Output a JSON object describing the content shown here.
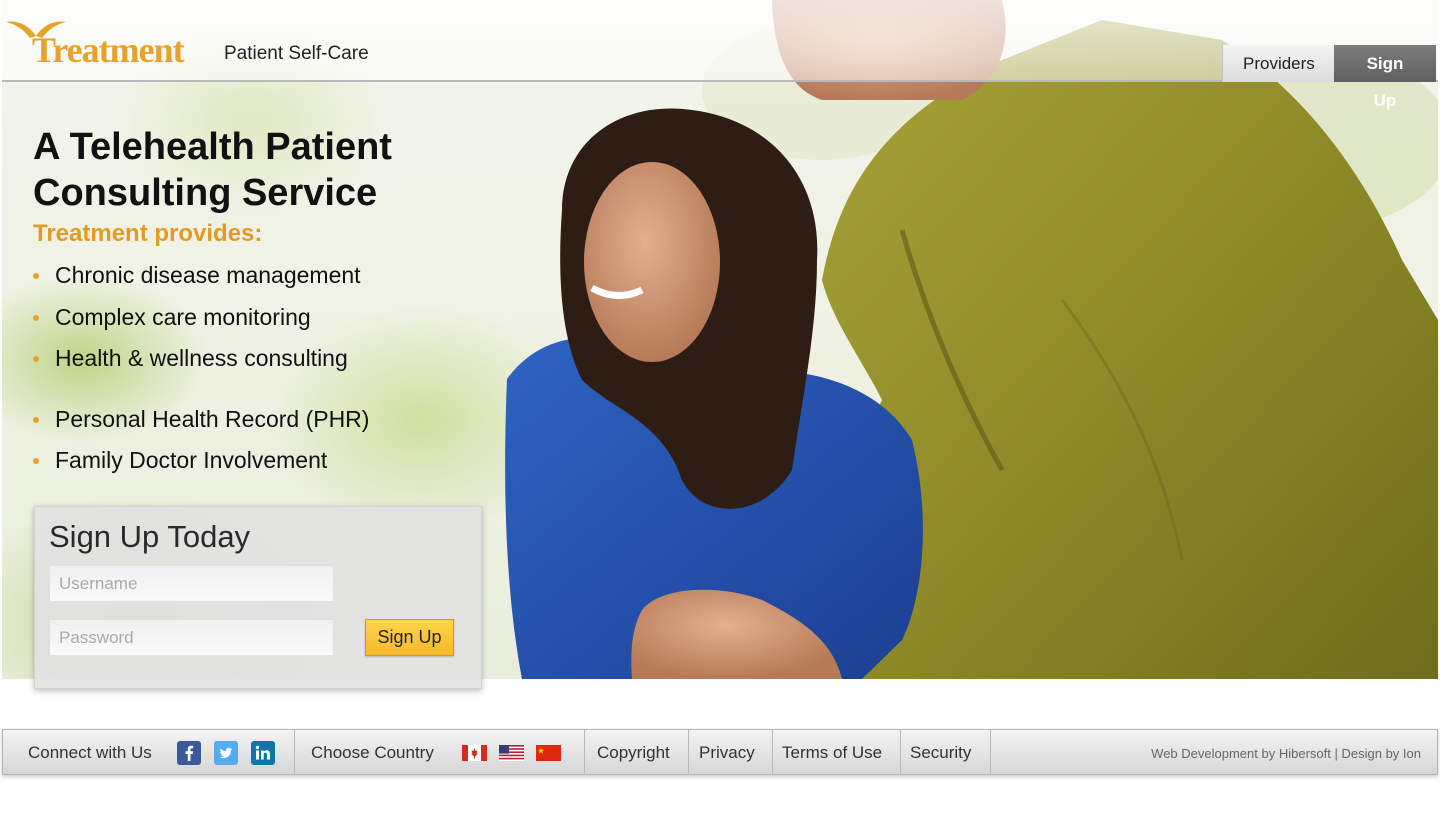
{
  "brand": {
    "logo_text": "Treatment",
    "tagline": "Patient Self-Care",
    "accent_color": "#e8a22a"
  },
  "nav": {
    "providers_label": "Providers",
    "signup_label": "Sign Up"
  },
  "hero": {
    "headline_line1": "A Telehealth Patient",
    "headline_line2": "Consulting Service",
    "provides_label": "Treatment provides:",
    "features": [
      "Chronic disease management",
      "Complex care monitoring",
      "Health & wellness consulting",
      "Personal Health Record (PHR)",
      "Family Doctor Involvement"
    ]
  },
  "signup_form": {
    "title": "Sign Up Today",
    "username_placeholder": "Username",
    "password_placeholder": "Password",
    "submit_label": "Sign Up",
    "button_color": "#f6b92a"
  },
  "footer": {
    "connect_label": "Connect with Us",
    "social_icons": [
      "facebook-icon",
      "twitter-icon",
      "linkedin-icon"
    ],
    "country_label": "Choose Country",
    "flags": [
      "canada-flag",
      "usa-flag",
      "china-flag"
    ],
    "links": [
      "Copyright",
      "Privacy",
      "Terms of Use",
      "Security"
    ],
    "credit_dev": "Web Development by Hibersoft",
    "credit_separator": "|",
    "credit_design": "Design by Ion"
  }
}
